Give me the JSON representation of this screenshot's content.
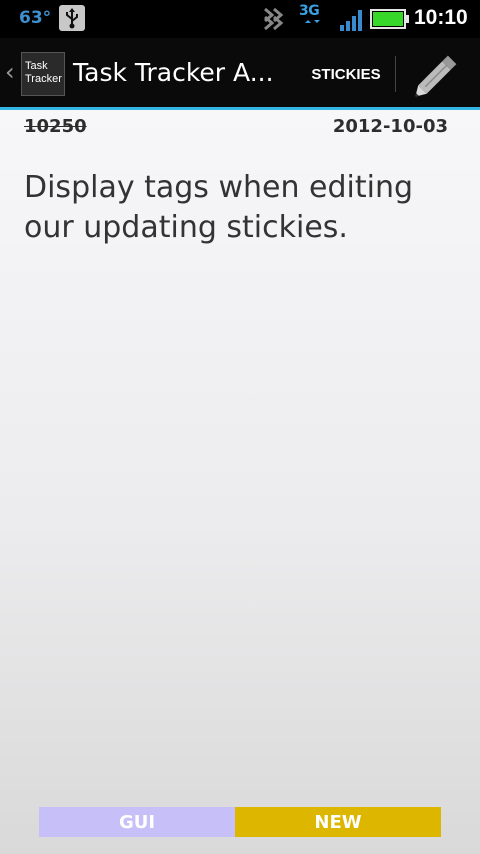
{
  "status_bar": {
    "temperature": "63°",
    "network_type": "3G",
    "time": "10:10",
    "icons": [
      "usb-icon",
      "signal-chevrons-icon",
      "3g-data-icon",
      "signal-bars-icon",
      "battery-icon"
    ]
  },
  "action_bar": {
    "app_icon_text_line1": "Task",
    "app_icon_text_line2": "Tracker",
    "title": "Task Tracker A...",
    "stickies_label": "STICKIES",
    "edit_icon": "pencil-icon",
    "accent_color": "#33b5e5"
  },
  "task": {
    "id": "10250",
    "date": "2012-10-03",
    "text": "Display tags when editing our updating stickies."
  },
  "tags": [
    {
      "label": "GUI",
      "color": "#c7bff7"
    },
    {
      "label": "NEW",
      "color": "#ddb600"
    }
  ]
}
